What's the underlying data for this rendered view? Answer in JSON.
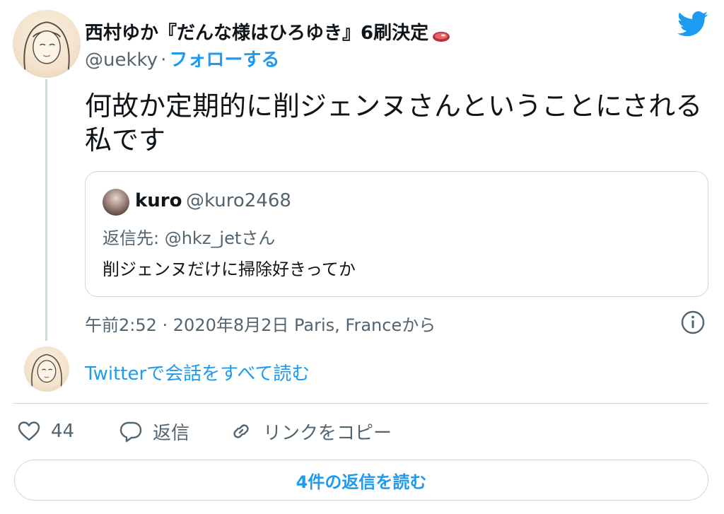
{
  "author": {
    "name": "西村ゆか『だんな様はひろゆき』6刷決定",
    "name_emoji": "steak-emoji",
    "handle": "@uekky",
    "separator": "·",
    "follow_label": "フォローする"
  },
  "tweet": {
    "text": "何故か定期的に削ジェンヌさんということにされる私です"
  },
  "quote": {
    "name": "kuro",
    "handle": "@kuro2468",
    "reply_to": "返信先: @hkz_jetさん",
    "text": "削ジェンヌだけに掃除好きってか"
  },
  "meta": {
    "timestamp": "午前2:52 · 2020年8月2日 Paris, Franceから"
  },
  "thread": {
    "read_conversation_label": "Twitterで会話をすべて読む"
  },
  "actions": {
    "like_count": "44",
    "reply_label": "返信",
    "copy_link_label": "リンクをコピー"
  },
  "footer": {
    "read_replies_label": "4件の返信を読む"
  },
  "colors": {
    "accent": "#1d9bf0",
    "secondary_text": "#536471",
    "border": "#cfd9de",
    "text": "#0f1419"
  },
  "icons": {
    "brand": "twitter-bird-icon",
    "info": "info-icon",
    "like": "heart-icon",
    "reply": "speech-bubble-icon",
    "copy_link": "link-icon"
  }
}
